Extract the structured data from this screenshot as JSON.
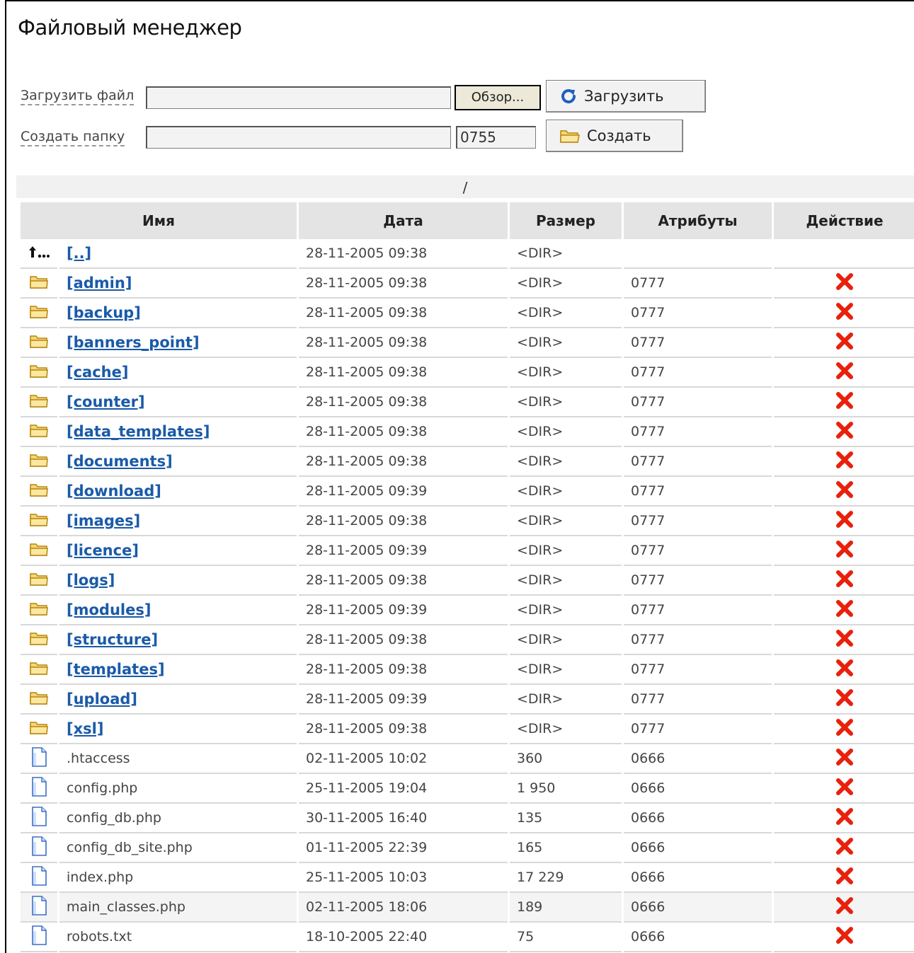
{
  "page": {
    "title": "Файловый менеджер"
  },
  "upload": {
    "label": "Загрузить файл",
    "value": "",
    "browse_label": "Обзор...",
    "submit_label": "Загрузить",
    "submit_icon": "refresh-arrow-icon"
  },
  "mkdir": {
    "label": "Создать папку",
    "value": "",
    "mode_value": "0755",
    "submit_label": "Создать",
    "submit_icon": "folder-icon"
  },
  "current_path": "/",
  "table": {
    "headers": [
      "Имя",
      "Дата",
      "Размер",
      "Атрибуты",
      "Действие"
    ],
    "rows": [
      {
        "type": "parent",
        "name": "[..]",
        "date": "28-11-2005 09:38",
        "size": "<DIR>",
        "attrs": "",
        "action": ""
      },
      {
        "type": "dir",
        "name": "[admin]",
        "date": "28-11-2005 09:38",
        "size": "<DIR>",
        "attrs": "0777",
        "action": "delete"
      },
      {
        "type": "dir",
        "name": "[backup]",
        "date": "28-11-2005 09:38",
        "size": "<DIR>",
        "attrs": "0777",
        "action": "delete"
      },
      {
        "type": "dir",
        "name": "[banners_point]",
        "date": "28-11-2005 09:38",
        "size": "<DIR>",
        "attrs": "0777",
        "action": "delete"
      },
      {
        "type": "dir",
        "name": "[cache]",
        "date": "28-11-2005 09:38",
        "size": "<DIR>",
        "attrs": "0777",
        "action": "delete"
      },
      {
        "type": "dir",
        "name": "[counter]",
        "date": "28-11-2005 09:38",
        "size": "<DIR>",
        "attrs": "0777",
        "action": "delete"
      },
      {
        "type": "dir",
        "name": "[data_templates]",
        "date": "28-11-2005 09:38",
        "size": "<DIR>",
        "attrs": "0777",
        "action": "delete"
      },
      {
        "type": "dir",
        "name": "[documents]",
        "date": "28-11-2005 09:38",
        "size": "<DIR>",
        "attrs": "0777",
        "action": "delete"
      },
      {
        "type": "dir",
        "name": "[download]",
        "date": "28-11-2005 09:39",
        "size": "<DIR>",
        "attrs": "0777",
        "action": "delete"
      },
      {
        "type": "dir",
        "name": "[images]",
        "date": "28-11-2005 09:38",
        "size": "<DIR>",
        "attrs": "0777",
        "action": "delete"
      },
      {
        "type": "dir",
        "name": "[licence]",
        "date": "28-11-2005 09:39",
        "size": "<DIR>",
        "attrs": "0777",
        "action": "delete"
      },
      {
        "type": "dir",
        "name": "[logs]",
        "date": "28-11-2005 09:38",
        "size": "<DIR>",
        "attrs": "0777",
        "action": "delete"
      },
      {
        "type": "dir",
        "name": "[modules]",
        "date": "28-11-2005 09:39",
        "size": "<DIR>",
        "attrs": "0777",
        "action": "delete"
      },
      {
        "type": "dir",
        "name": "[structure]",
        "date": "28-11-2005 09:38",
        "size": "<DIR>",
        "attrs": "0777",
        "action": "delete"
      },
      {
        "type": "dir",
        "name": "[templates]",
        "date": "28-11-2005 09:38",
        "size": "<DIR>",
        "attrs": "0777",
        "action": "delete"
      },
      {
        "type": "dir",
        "name": "[upload]",
        "date": "28-11-2005 09:39",
        "size": "<DIR>",
        "attrs": "0777",
        "action": "delete"
      },
      {
        "type": "dir",
        "name": "[xsl]",
        "date": "28-11-2005 09:38",
        "size": "<DIR>",
        "attrs": "0777",
        "action": "delete"
      },
      {
        "type": "file",
        "name": ".htaccess",
        "date": "02-11-2005 10:02",
        "size": "360",
        "attrs": "0666",
        "action": "delete"
      },
      {
        "type": "file",
        "name": "config.php",
        "date": "25-11-2005 19:04",
        "size": "1 950",
        "attrs": "0666",
        "action": "delete"
      },
      {
        "type": "file",
        "name": "config_db.php",
        "date": "30-11-2005 16:40",
        "size": "135",
        "attrs": "0666",
        "action": "delete"
      },
      {
        "type": "file",
        "name": "config_db_site.php",
        "date": "01-11-2005 22:39",
        "size": "165",
        "attrs": "0666",
        "action": "delete"
      },
      {
        "type": "file",
        "name": "index.php",
        "date": "25-11-2005 10:03",
        "size": "17 229",
        "attrs": "0666",
        "action": "delete"
      },
      {
        "type": "file",
        "name": "main_classes.php",
        "date": "02-11-2005 18:06",
        "size": "189",
        "attrs": "0666",
        "action": "delete",
        "highlighted": true
      },
      {
        "type": "file",
        "name": "robots.txt",
        "date": "18-10-2005 22:40",
        "size": "75",
        "attrs": "0666",
        "action": "delete"
      }
    ]
  },
  "colors": {
    "link": "#1a5aa8",
    "delete_icon": "#e8200c",
    "folder_fill": "#f5d77a",
    "header_bg": "#e4e4e4"
  }
}
